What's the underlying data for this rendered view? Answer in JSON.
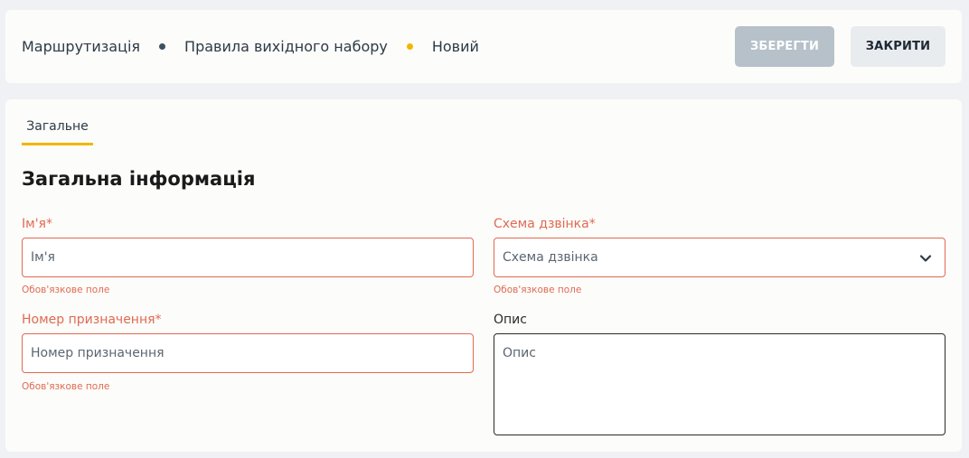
{
  "breadcrumb": {
    "items": [
      "Маршрутизація",
      "Правила вихідного набору",
      "Новий"
    ],
    "dot_colors": [
      "#3d4f63",
      "#f2b600"
    ]
  },
  "toolbar": {
    "save_label": "ЗБЕРЕГТИ",
    "close_label": "ЗАКРИТИ"
  },
  "tabs": [
    {
      "label": "Загальне",
      "active": true
    }
  ],
  "section": {
    "title": "Загальна інформація"
  },
  "form": {
    "name": {
      "label": "Ім'я*",
      "placeholder": "Ім'я",
      "error": "Обов'язкове поле"
    },
    "call_scheme": {
      "label": "Схема дзвінка*",
      "placeholder": "Схема дзвінка",
      "error": "Обов'язкове поле"
    },
    "destination_number": {
      "label": "Номер призначення*",
      "placeholder": "Номер призначення",
      "error": "Обов'язкове поле"
    },
    "description": {
      "label": "Опис",
      "placeholder": "Опис"
    }
  },
  "colors": {
    "accent": "#f2b600",
    "error": "#e06a52"
  }
}
